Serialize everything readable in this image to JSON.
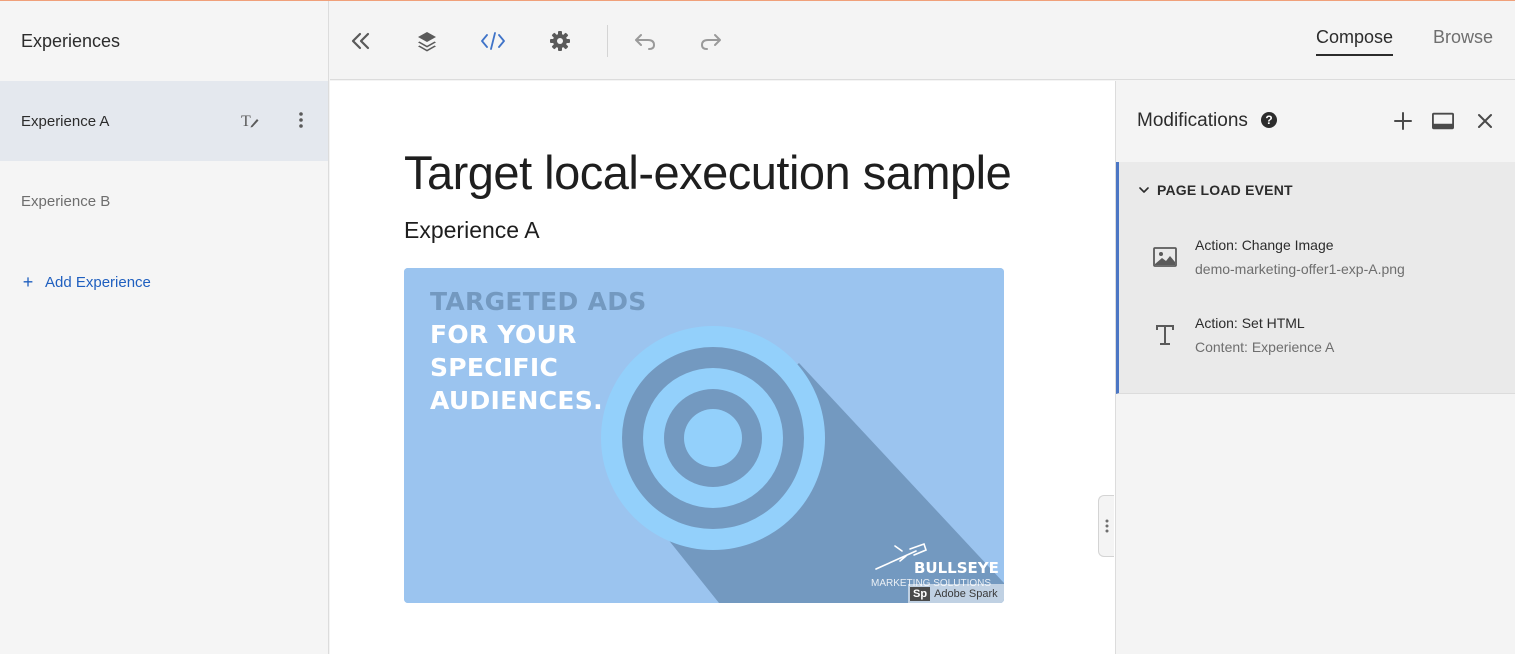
{
  "sidebar": {
    "title": "Experiences",
    "items": [
      {
        "label": "Experience A",
        "selected": true
      },
      {
        "label": "Experience B",
        "selected": false
      }
    ],
    "add_label": "Add Experience"
  },
  "toolbar": {
    "buttons": [
      "collapse-icon",
      "layers-icon",
      "code-icon",
      "gear-icon",
      "undo-icon",
      "redo-icon"
    ],
    "tabs": [
      {
        "label": "Compose",
        "active": true
      },
      {
        "label": "Browse",
        "active": false
      }
    ]
  },
  "canvas": {
    "title": "Target local-execution sample",
    "subtitle": "Experience A",
    "banner": {
      "line1": "TARGETED ADS",
      "line2": "FOR YOUR",
      "line3": "SPECIFIC",
      "line4": "AUDIENCES.",
      "brand": "BULLSEYE",
      "brand_sub": "MARKETING SOLUTIONS",
      "spark_badge": "Sp",
      "spark_label": "Adobe Spark"
    }
  },
  "panel": {
    "title": "Modifications",
    "help": "?",
    "event_title": "PAGE LOAD EVENT",
    "actions": [
      {
        "title": "Action: Change Image",
        "detail": "demo-marketing-offer1-exp-A.png",
        "icon": "image-icon"
      },
      {
        "title": "Action: Set HTML",
        "detail": "Content: Experience A",
        "icon": "text-icon"
      }
    ]
  },
  "colors": {
    "accent": "#1f5fbf",
    "event_border": "#4b76c4",
    "banner_bg": "#9bc4ef",
    "banner_dark": "#7399c0",
    "banner_light": "#93d0fb"
  }
}
